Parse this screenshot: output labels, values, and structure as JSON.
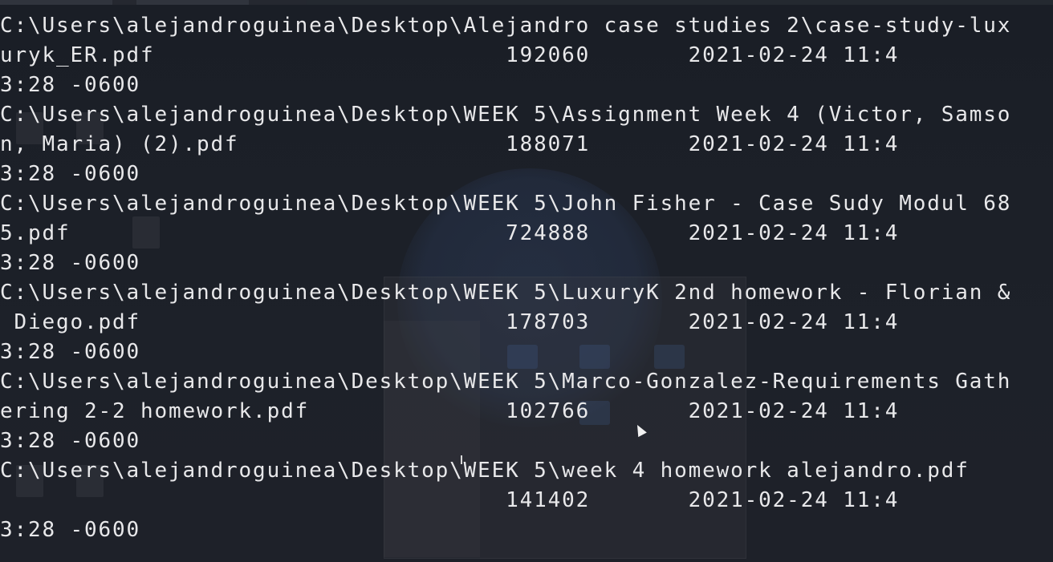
{
  "terminal": {
    "lines": [
      "C:\\Users\\alejandroguinea\\Desktop\\Alejandro case studies 2\\case-study-lux",
      "uryk_ER.pdf                         192060       2021-02-24 11:4",
      "3:28 -0600",
      "C:\\Users\\alejandroguinea\\Desktop\\WEEK 5\\Assignment Week 4 (Victor, Samso",
      "n, Maria) (2).pdf                   188071       2021-02-24 11:4",
      "3:28 -0600",
      "C:\\Users\\alejandroguinea\\Desktop\\WEEK 5\\John Fisher - Case Sudy Modul 68",
      "5.pdf                               724888       2021-02-24 11:4",
      "3:28 -0600",
      "C:\\Users\\alejandroguinea\\Desktop\\WEEK 5\\LuxuryK 2nd homework - Florian &",
      " Diego.pdf                          178703       2021-02-24 11:4",
      "3:28 -0600",
      "C:\\Users\\alejandroguinea\\Desktop\\WEEK 5\\Marco-Gonzalez-Requirements Gath",
      "ering 2-2 homework.pdf              102766       2021-02-24 11:4",
      "3:28 -0600",
      "C:\\Users\\alejandroguinea\\Desktop\\WEEK 5\\week 4 homework alejandro.pdf",
      "                                    141402       2021-02-24 11:4",
      "3:28 -0600"
    ]
  },
  "colors": {
    "background": "#1b1f27",
    "text": "#e8e8ea"
  }
}
